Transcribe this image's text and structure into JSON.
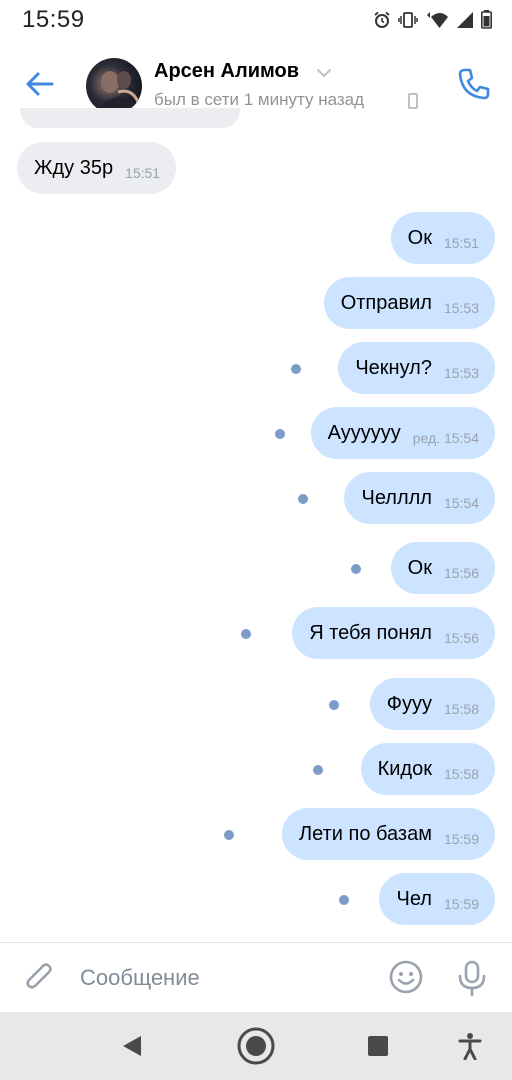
{
  "status_bar": {
    "time": "15:59"
  },
  "header": {
    "contact_name": "Арсен Алимов",
    "last_seen": "был в сети 1 минуту назад"
  },
  "messages": [
    {
      "direction": "in",
      "text": "Жду 35р",
      "time": "15:51",
      "unread": false
    },
    {
      "direction": "out",
      "text": "Ок",
      "time": "15:51",
      "unread": false
    },
    {
      "direction": "out",
      "text": "Отправил",
      "time": "15:53",
      "unread": false
    },
    {
      "direction": "out",
      "text": "Чекнул?",
      "time": "15:53",
      "unread": true
    },
    {
      "direction": "out",
      "text": "Ауууууу",
      "edited": "ред.",
      "time": "15:54",
      "unread": true
    },
    {
      "direction": "out",
      "text": "Челллл",
      "time": "15:54",
      "unread": true
    },
    {
      "direction": "out",
      "text": "Ок",
      "time": "15:56",
      "unread": true
    },
    {
      "direction": "out",
      "text": "Я тебя понял",
      "time": "15:56",
      "unread": true
    },
    {
      "direction": "out",
      "text": "Фууу",
      "time": "15:58",
      "unread": true
    },
    {
      "direction": "out",
      "text": "Кидок",
      "time": "15:58",
      "unread": true
    },
    {
      "direction": "out",
      "text": "Лети по базам",
      "time": "15:59",
      "unread": true
    },
    {
      "direction": "out",
      "text": "Чел",
      "time": "15:59",
      "unread": true
    }
  ],
  "composer": {
    "placeholder": "Сообщение",
    "value": ""
  },
  "colors": {
    "accent": "#3f8ae0",
    "incoming_bubble": "#ebedf0",
    "outgoing_bubble": "#cce4ff",
    "unread_dot": "#7a9cc6"
  },
  "icons": {
    "back": "arrow-left-icon",
    "call": "phone-icon",
    "attach": "paperclip-icon",
    "emoji": "smile-icon",
    "voice": "microphone-icon"
  }
}
